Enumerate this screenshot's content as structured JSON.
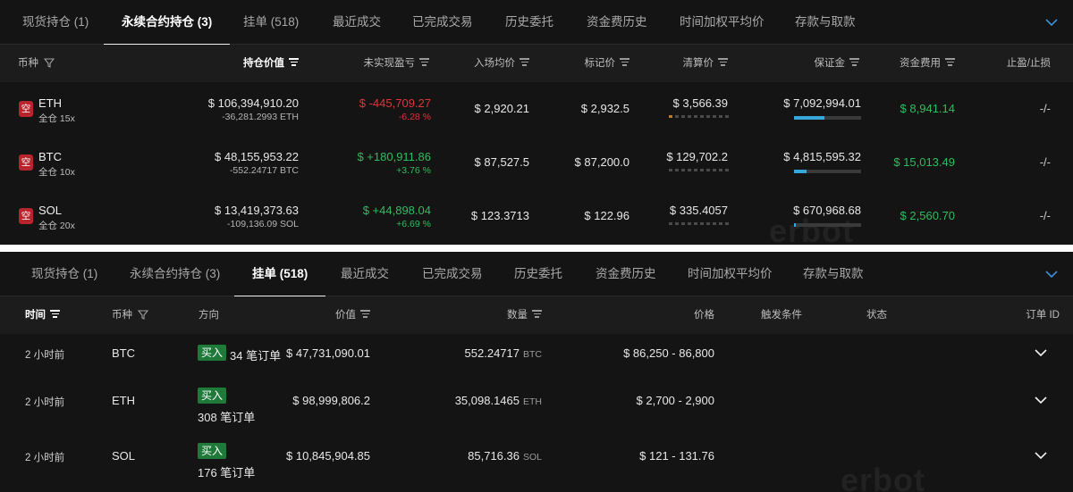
{
  "tabs": [
    "现货持仓 (1)",
    "永续合约持仓 (3)",
    "挂单 (518)",
    "最近成交",
    "已完成交易",
    "历史委托",
    "资金费历史",
    "时间加权平均价",
    "存款与取款"
  ],
  "icons": {
    "collapse": "chevron-down-icon",
    "filter": "filter-icon",
    "sort": "sort-icon",
    "expand": "chevron-down-icon"
  },
  "colors": {
    "positive": "#2ebd5f",
    "negative": "#e0343a",
    "short_badge": "#b8242b",
    "buy_badge": "#1f7a3a",
    "accent_bar": "#37a6d8"
  },
  "watermark": "erbot",
  "positions_panel": {
    "active_tab": "永续合约持仓 (3)",
    "headers": {
      "symbol": "币种",
      "position_value": "持仓价值",
      "unrealized_pnl": "未实现盈亏",
      "entry_price": "入场均价",
      "mark_price": "标记价",
      "liq_price": "清算价",
      "margin": "保证金",
      "funding": "资金费用",
      "tpsl": "止盈/止损"
    },
    "rows": [
      {
        "side_badge": "空",
        "symbol": "ETH",
        "leverage": "全仓 15x",
        "value": "$ 106,394,910.20",
        "size": "-36,281.2993 ETH",
        "pnl": "$ -445,709.27",
        "pnl_pct": "-6.28 %",
        "pnl_sign": "negative",
        "entry": "$ 2,920.21",
        "mark": "$ 2,932.5",
        "liq": "$ 3,566.39",
        "liq_risk_level": 1,
        "margin": "$ 7,092,994.01",
        "margin_ratio": 0.45,
        "funding": "$ 8,941.14",
        "tpsl": "-/-"
      },
      {
        "side_badge": "空",
        "symbol": "BTC",
        "leverage": "全仓 10x",
        "value": "$ 48,155,953.22",
        "size": "-552.24717 BTC",
        "pnl": "$ +180,911.86",
        "pnl_pct": "+3.76 %",
        "pnl_sign": "positive",
        "entry": "$ 87,527.5",
        "mark": "$ 87,200.0",
        "liq": "$ 129,702.2",
        "liq_risk_level": 0,
        "margin": "$ 4,815,595.32",
        "margin_ratio": 0.18,
        "funding": "$ 15,013.49",
        "tpsl": "-/-"
      },
      {
        "side_badge": "空",
        "symbol": "SOL",
        "leverage": "全仓 20x",
        "value": "$ 13,419,373.63",
        "size": "-109,136.09 SOL",
        "pnl": "$ +44,898.04",
        "pnl_pct": "+6.69 %",
        "pnl_sign": "positive",
        "entry": "$ 123.3713",
        "mark": "$ 122.96",
        "liq": "$ 335.4057",
        "liq_risk_level": 0,
        "margin": "$ 670,968.68",
        "margin_ratio": 0.03,
        "funding": "$ 2,560.70",
        "tpsl": "-/-"
      }
    ]
  },
  "orders_panel": {
    "active_tab": "挂单 (518)",
    "headers": {
      "time": "时间",
      "symbol": "币种",
      "direction": "方向",
      "value": "价值",
      "quantity": "数量",
      "price": "价格",
      "trigger": "触发条件",
      "status": "状态",
      "order_id": "订单 ID"
    },
    "rows": [
      {
        "time": "2 小时前",
        "symbol": "BTC",
        "side": "买入",
        "count": "34 笔订单",
        "value": "$ 47,731,090.01",
        "qty": "552.24717",
        "qty_unit": "BTC",
        "price": "$ 86,250 - 86,800"
      },
      {
        "time": "2 小时前",
        "symbol": "ETH",
        "side": "买入",
        "count": "308 笔订单",
        "value": "$ 98,999,806.2",
        "qty": "35,098.1465",
        "qty_unit": "ETH",
        "price": "$ 2,700 - 2,900"
      },
      {
        "time": "2 小时前",
        "symbol": "SOL",
        "side": "买入",
        "count": "176 笔订单",
        "value": "$ 10,845,904.85",
        "qty": "85,716.36",
        "qty_unit": "SOL",
        "price": "$ 121 - 131.76"
      }
    ]
  }
}
